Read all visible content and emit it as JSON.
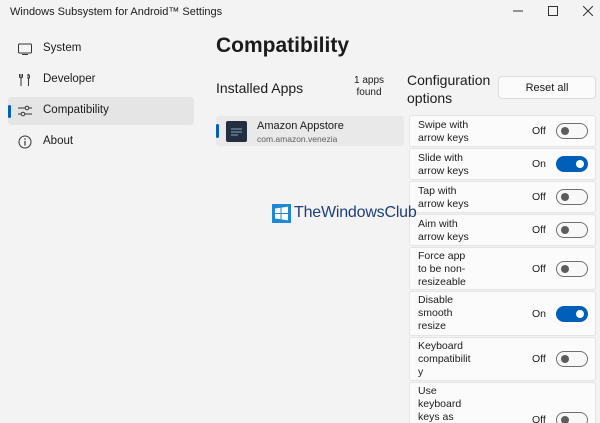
{
  "window": {
    "title": "Windows Subsystem for Android™ Settings"
  },
  "sidebar": {
    "items": [
      {
        "label": "System",
        "icon": "monitor-icon"
      },
      {
        "label": "Developer",
        "icon": "tools-icon"
      },
      {
        "label": "Compatibility",
        "icon": "sliders-icon",
        "selected": true
      },
      {
        "label": "About",
        "icon": "info-icon"
      }
    ]
  },
  "main": {
    "title": "Compatibility",
    "installed_apps": {
      "heading": "Installed Apps",
      "count_line1": "1 apps",
      "count_line2": "found",
      "apps": [
        {
          "name": "Amazon Appstore",
          "package": "com.amazon.venezia"
        }
      ]
    },
    "config": {
      "heading_line1": "Configuration",
      "heading_line2": "options",
      "reset_label": "Reset all",
      "options": [
        {
          "line1": "Swipe with",
          "line2": "arrow keys",
          "line3": "",
          "state": "Off",
          "on": false
        },
        {
          "line1": "Slide with",
          "line2": "arrow keys",
          "line3": "",
          "state": "On",
          "on": true
        },
        {
          "line1": "Tap with",
          "line2": "arrow keys",
          "line3": "",
          "state": "Off",
          "on": false
        },
        {
          "line1": "Aim with",
          "line2": "arrow keys",
          "line3": "",
          "state": "Off",
          "on": false
        },
        {
          "line1": "Force app",
          "line2": "to be non-",
          "line3": "resizeable",
          "state": "Off",
          "on": false
        },
        {
          "line1": "Disable",
          "line2": "smooth",
          "line3": "resize",
          "state": "On",
          "on": true
        },
        {
          "line1": "Keyboard",
          "line2": "compatibilit",
          "line3": "y",
          "state": "Off",
          "on": false
        },
        {
          "line1": "Use",
          "line2": "keyboard",
          "line3": "keys as",
          "state": "Off",
          "on": false
        }
      ]
    }
  },
  "watermark": {
    "text": "TheWindowsClub"
  },
  "colors": {
    "accent": "#005fb8",
    "background": "#f3f3f3"
  }
}
